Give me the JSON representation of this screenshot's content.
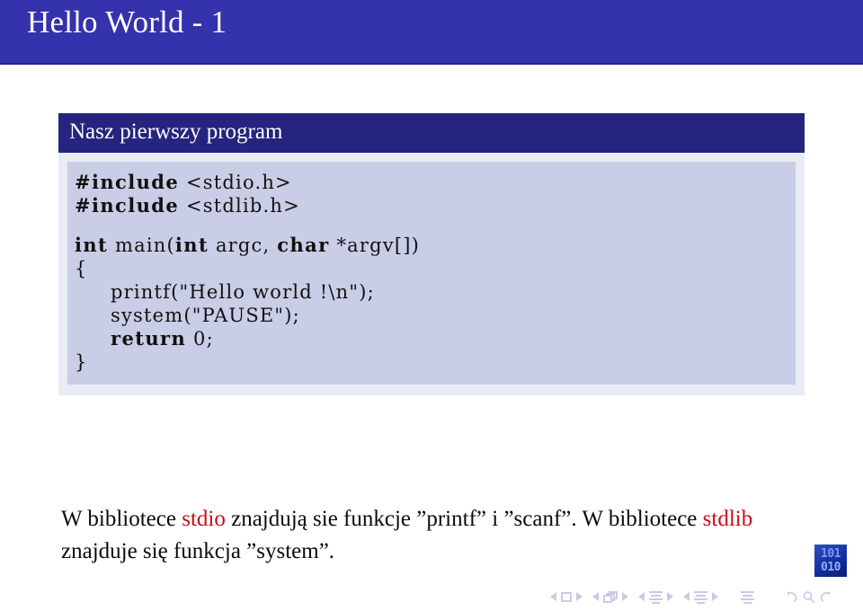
{
  "slide": {
    "title": "Hello World - 1",
    "header_color": "#3432ac"
  },
  "block": {
    "title": "Nasz pierwszy program",
    "title_bar_color": "#25247e",
    "body_color": "#e9ebf5",
    "code_bg_color": "#c9cde6",
    "code_lines": [
      {
        "indent": 0,
        "parts": [
          {
            "text": "#include",
            "bold": true
          },
          {
            "text": " <stdio.h>",
            "bold": false
          }
        ]
      },
      {
        "indent": 0,
        "parts": [
          {
            "text": "#include",
            "bold": true
          },
          {
            "text": " <stdlib.h>",
            "bold": false
          }
        ]
      },
      {
        "indent": 0,
        "parts": [
          {
            "text": "",
            "bold": false
          }
        ]
      },
      {
        "indent": 0,
        "parts": [
          {
            "text": "int",
            "bold": true
          },
          {
            "text": " main(",
            "bold": false
          },
          {
            "text": "int",
            "bold": true
          },
          {
            "text": " argc, ",
            "bold": false
          },
          {
            "text": "char",
            "bold": true
          },
          {
            "text": " *argv[])",
            "bold": false
          }
        ]
      },
      {
        "indent": 0,
        "parts": [
          {
            "text": "{",
            "bold": false
          }
        ]
      },
      {
        "indent": 1,
        "parts": [
          {
            "text": "printf(\"Hello world !\\n\");",
            "bold": false
          }
        ]
      },
      {
        "indent": 1,
        "parts": [
          {
            "text": "system(\"PAUSE\");",
            "bold": false
          }
        ]
      },
      {
        "indent": 1,
        "parts": [
          {
            "text": "return",
            "bold": true
          },
          {
            "text": " 0;",
            "bold": false
          }
        ]
      },
      {
        "indent": 0,
        "parts": [
          {
            "text": "}",
            "bold": false
          }
        ]
      }
    ]
  },
  "body_text": {
    "highlight_color": "#cc0a16",
    "segments": [
      {
        "text": "W bibliotece ",
        "highlight": false
      },
      {
        "text": "stdio",
        "highlight": true
      },
      {
        "text": " znajdują sie funkcje ”printf” i ”scanf”. W bibliotece ",
        "highlight": false
      },
      {
        "text": "stdlib",
        "highlight": true
      },
      {
        "text": " znajduje się funkcja ”system”.",
        "highlight": false
      }
    ]
  },
  "logo": {
    "line1": "101",
    "line2": "010"
  },
  "navigation": {
    "items": [
      {
        "name": "slide-prev",
        "glyph": "triangle-left-icon"
      },
      {
        "name": "slide-current",
        "glyph": "square-icon"
      },
      {
        "name": "slide-next",
        "glyph": "triangle-right-icon"
      },
      {
        "name": "frame-prev",
        "glyph": "triangle-left-icon"
      },
      {
        "name": "frame-current",
        "glyph": "frames-icon"
      },
      {
        "name": "frame-next",
        "glyph": "triangle-right-icon"
      },
      {
        "name": "subsection-prev",
        "glyph": "triangle-left-icon"
      },
      {
        "name": "subsection-current",
        "glyph": "lines-icon"
      },
      {
        "name": "subsection-next",
        "glyph": "triangle-right-icon"
      },
      {
        "name": "section-prev",
        "glyph": "triangle-left-icon"
      },
      {
        "name": "section-current",
        "glyph": "lines-icon"
      },
      {
        "name": "section-next",
        "glyph": "triangle-right-icon"
      },
      {
        "name": "presentation-overview",
        "glyph": "lines-icon"
      },
      {
        "name": "back-button",
        "glyph": "arc-back-icon"
      },
      {
        "name": "search-button",
        "glyph": "magnifier-icon"
      },
      {
        "name": "forward-button",
        "glyph": "arc-forward-icon"
      }
    ]
  }
}
